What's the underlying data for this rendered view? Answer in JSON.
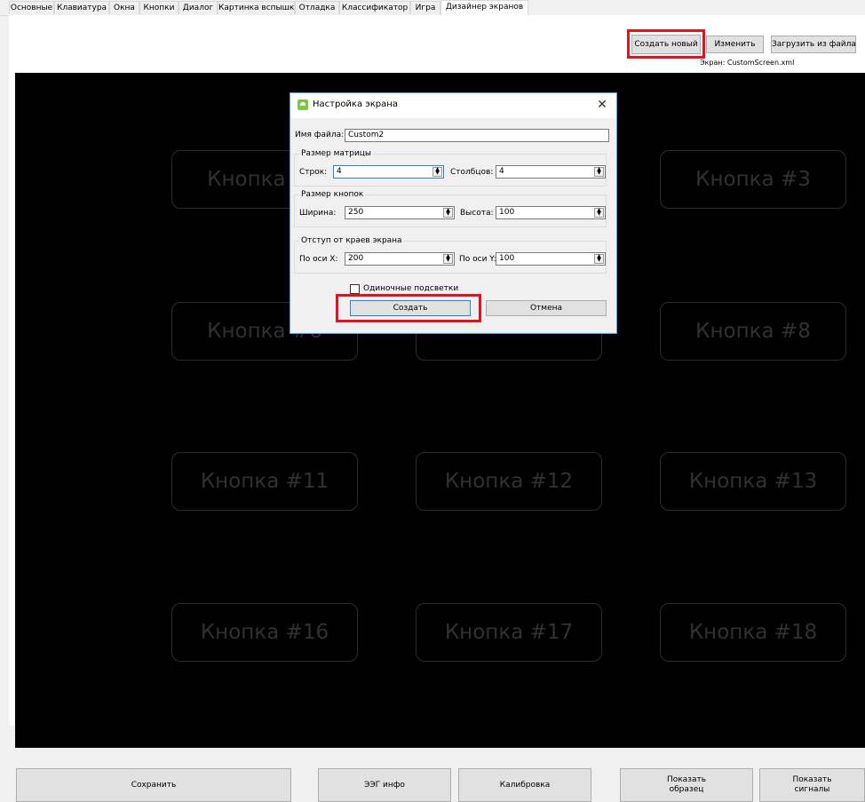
{
  "tabs": [
    {
      "label": "Основные"
    },
    {
      "label": "Клавиатура"
    },
    {
      "label": "Окна"
    },
    {
      "label": "Кнопки"
    },
    {
      "label": "Диалог"
    },
    {
      "label": "Картинка вспышки"
    },
    {
      "label": "Отладка"
    },
    {
      "label": "Классификатор"
    },
    {
      "label": "Игра"
    },
    {
      "label": "Дизайнер экранов"
    }
  ],
  "toolbar": {
    "create_new": "Создать новый",
    "edit": "Изменить",
    "load_file": "Загрузить из файла",
    "screen_label": "Экран: CustomScreen.xml"
  },
  "cells": [
    {
      "label": "Кнопка #1"
    },
    {
      "label": "Кнопка #3"
    },
    {
      "label": "Кнопка #6"
    },
    {
      "label": "Кнопка #8"
    },
    {
      "label": "Кнопка #11"
    },
    {
      "label": "Кнопка #12"
    },
    {
      "label": "Кнопка #13"
    },
    {
      "label": "Кнопка #16"
    },
    {
      "label": "Кнопка #17"
    },
    {
      "label": "Кнопка #18"
    }
  ],
  "dialog": {
    "title": "Настройка экрана",
    "file_label": "Имя файла:",
    "file_value": "Custom2",
    "matrix_group": "Размер матрицы",
    "rows_label": "Строк:",
    "rows_value": "4",
    "cols_label": "Столбцов:",
    "cols_value": "4",
    "button_group": "Размер кнопок",
    "width_label": "Ширина:",
    "width_value": "250",
    "height_label": "Высота:",
    "height_value": "100",
    "margin_group": "Отступ от краев экрана",
    "x_label": "По оси X:",
    "x_value": "200",
    "y_label": "По оси Y:",
    "y_value": "100",
    "single_highlight_label": "Одиночные подсветки",
    "single_highlight_checked": false,
    "create": "Создать",
    "cancel": "Отмена"
  },
  "bottom": {
    "save": "Сохранить",
    "eeg_info": "ЭЭГ инфо",
    "calibration": "Калибровка",
    "show_sample": "Показать\nобразец",
    "show_signals": "Показать\nсигналы"
  },
  "colors": {
    "highlight": "#e0141c",
    "canvas": "#000000",
    "cell_text": "#313131",
    "dialog_border": "#4a9ff0"
  },
  "icons": {
    "dialog_app": "app-icon",
    "close": "close-icon",
    "spin": "spin-arrows-icon"
  }
}
